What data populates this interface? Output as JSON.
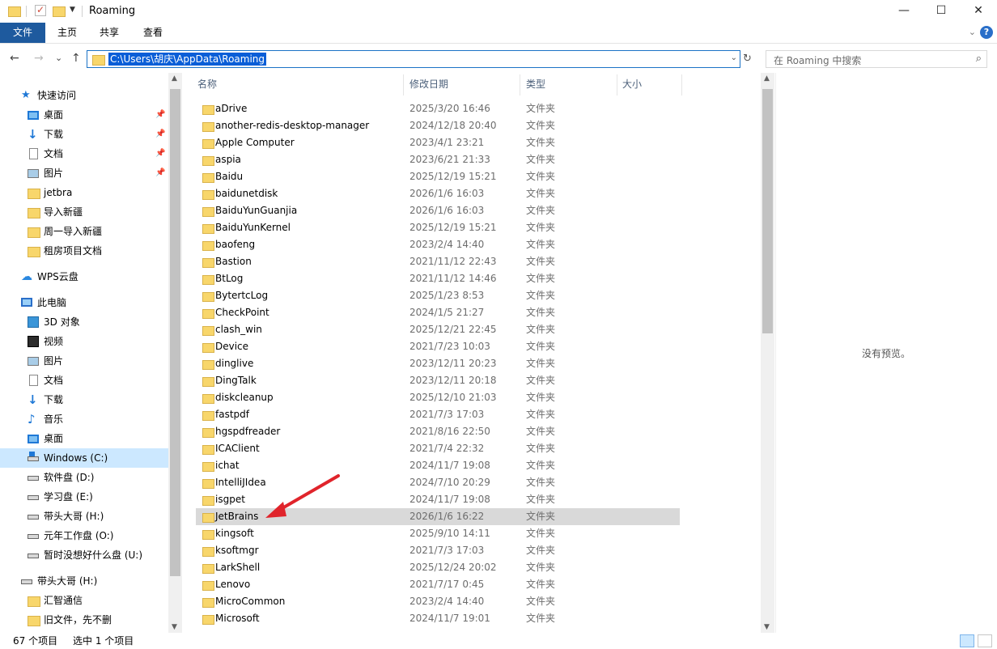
{
  "window": {
    "title": "Roaming",
    "minimize_glyph": "—",
    "maximize_glyph": "☐",
    "close_glyph": "✕"
  },
  "ribbon": {
    "tabs": [
      "文件",
      "主页",
      "共享",
      "查看"
    ],
    "expand_glyph": "⌄",
    "help_glyph": "?"
  },
  "nav": {
    "back_glyph": "←",
    "forward_glyph": "→",
    "recent_glyph": "⌄",
    "up_glyph": "↑",
    "address": "C:\\Users\\胡庆\\AppData\\Roaming",
    "address_drop_glyph": "⌄",
    "refresh_glyph": "↻",
    "search_placeholder": "在 Roaming 中搜索",
    "search_icon_glyph": "⌕"
  },
  "sidebar": {
    "items": [
      {
        "label": "快速访问",
        "icon": "star-icon",
        "level": 0
      },
      {
        "label": "桌面",
        "icon": "desktop-icon",
        "level": 1,
        "pinned": true
      },
      {
        "label": "下载",
        "icon": "download-icon",
        "level": 1,
        "pinned": true
      },
      {
        "label": "文档",
        "icon": "document-icon",
        "level": 1,
        "pinned": true
      },
      {
        "label": "图片",
        "icon": "pictures-icon",
        "level": 1,
        "pinned": true
      },
      {
        "label": "jetbra",
        "icon": "folder-icon",
        "level": 1
      },
      {
        "label": "导入新疆",
        "icon": "folder-icon",
        "level": 1
      },
      {
        "label": "周一导入新疆",
        "icon": "folder-icon",
        "level": 1
      },
      {
        "label": "租房项目文档",
        "icon": "folder-icon",
        "level": 1
      },
      {
        "label": "WPS云盘",
        "icon": "cloud-icon",
        "level": 0
      },
      {
        "label": "此电脑",
        "icon": "computer-icon",
        "level": 0
      },
      {
        "label": "3D 对象",
        "icon": "3d-objects-icon",
        "level": 1
      },
      {
        "label": "视频",
        "icon": "video-icon",
        "level": 1
      },
      {
        "label": "图片",
        "icon": "pictures-icon",
        "level": 1
      },
      {
        "label": "文档",
        "icon": "document-icon",
        "level": 1
      },
      {
        "label": "下载",
        "icon": "download-icon",
        "level": 1
      },
      {
        "label": "音乐",
        "icon": "music-icon",
        "level": 1
      },
      {
        "label": "桌面",
        "icon": "desktop-icon",
        "level": 1
      },
      {
        "label": "Windows (C:)",
        "icon": "windows-drive-icon",
        "level": 1,
        "selected": true
      },
      {
        "label": "软件盘 (D:)",
        "icon": "drive-icon",
        "level": 1
      },
      {
        "label": "学习盘 (E:)",
        "icon": "drive-icon",
        "level": 1
      },
      {
        "label": "带头大哥 (H:)",
        "icon": "drive-icon",
        "level": 1
      },
      {
        "label": "元年工作盘 (O:)",
        "icon": "drive-icon",
        "level": 1
      },
      {
        "label": "暂时没想好什么盘 (U:)",
        "icon": "drive-icon",
        "level": 1
      },
      {
        "label": "带头大哥 (H:)",
        "icon": "drive-icon",
        "level": 0
      },
      {
        "label": "汇智通信",
        "icon": "folder-icon",
        "level": 1
      },
      {
        "label": "旧文件，先不删",
        "icon": "folder-icon",
        "level": 1
      }
    ],
    "pin_glyph": "📌"
  },
  "filelist": {
    "columns": [
      "名称",
      "修改日期",
      "类型",
      "大小"
    ],
    "sort_glyph": "^",
    "rows": [
      {
        "name": "aDrive",
        "date": "2025/3/20 16:46",
        "type": "文件夹"
      },
      {
        "name": "another-redis-desktop-manager",
        "date": "2024/12/18 20:40",
        "type": "文件夹"
      },
      {
        "name": "Apple Computer",
        "date": "2023/4/1 23:21",
        "type": "文件夹"
      },
      {
        "name": "aspia",
        "date": "2023/6/21 21:33",
        "type": "文件夹"
      },
      {
        "name": "Baidu",
        "date": "2025/12/19 15:21",
        "type": "文件夹"
      },
      {
        "name": "baidunetdisk",
        "date": "2026/1/6 16:03",
        "type": "文件夹"
      },
      {
        "name": "BaiduYunGuanjia",
        "date": "2026/1/6 16:03",
        "type": "文件夹"
      },
      {
        "name": "BaiduYunKernel",
        "date": "2025/12/19 15:21",
        "type": "文件夹"
      },
      {
        "name": "baofeng",
        "date": "2023/2/4 14:40",
        "type": "文件夹"
      },
      {
        "name": "Bastion",
        "date": "2021/11/12 22:43",
        "type": "文件夹"
      },
      {
        "name": "BtLog",
        "date": "2021/11/12 14:46",
        "type": "文件夹"
      },
      {
        "name": "BytertcLog",
        "date": "2025/1/23 8:53",
        "type": "文件夹"
      },
      {
        "name": "CheckPoint",
        "date": "2024/1/5 21:27",
        "type": "文件夹"
      },
      {
        "name": "clash_win",
        "date": "2025/12/21 22:45",
        "type": "文件夹"
      },
      {
        "name": "Device",
        "date": "2021/7/23 10:03",
        "type": "文件夹"
      },
      {
        "name": "dinglive",
        "date": "2023/12/11 20:23",
        "type": "文件夹"
      },
      {
        "name": "DingTalk",
        "date": "2023/12/11 20:18",
        "type": "文件夹"
      },
      {
        "name": "diskcleanup",
        "date": "2025/12/10 21:03",
        "type": "文件夹"
      },
      {
        "name": "fastpdf",
        "date": "2021/7/3 17:03",
        "type": "文件夹"
      },
      {
        "name": "hgspdfreader",
        "date": "2021/8/16 22:50",
        "type": "文件夹"
      },
      {
        "name": "ICAClient",
        "date": "2021/7/4 22:32",
        "type": "文件夹"
      },
      {
        "name": "ichat",
        "date": "2024/11/7 19:08",
        "type": "文件夹"
      },
      {
        "name": "IntelliJIdea",
        "date": "2024/7/10 20:29",
        "type": "文件夹"
      },
      {
        "name": "isgpet",
        "date": "2024/11/7 19:08",
        "type": "文件夹"
      },
      {
        "name": "JetBrains",
        "date": "2026/1/6 16:22",
        "type": "文件夹",
        "selected": true
      },
      {
        "name": "kingsoft",
        "date": "2025/9/10 14:11",
        "type": "文件夹"
      },
      {
        "name": "ksoftmgr",
        "date": "2021/7/3 17:03",
        "type": "文件夹"
      },
      {
        "name": "LarkShell",
        "date": "2025/12/24 20:02",
        "type": "文件夹"
      },
      {
        "name": "Lenovo",
        "date": "2021/7/17 0:45",
        "type": "文件夹"
      },
      {
        "name": "MicroCommon",
        "date": "2023/2/4 14:40",
        "type": "文件夹"
      },
      {
        "name": "Microsoft",
        "date": "2024/11/7 19:01",
        "type": "文件夹"
      }
    ]
  },
  "preview": {
    "message": "没有预览。"
  },
  "statusbar": {
    "count": "67 个项目",
    "selection": "选中 1 个项目"
  },
  "colors": {
    "file_tab": "#1e5a9e",
    "selection_highlight": "#cce8ff",
    "selected_row": "#d9d9d9",
    "address_selection": "#0a5ed7",
    "annotation_arrow": "#e0242b",
    "folder": "#f8d66b"
  }
}
